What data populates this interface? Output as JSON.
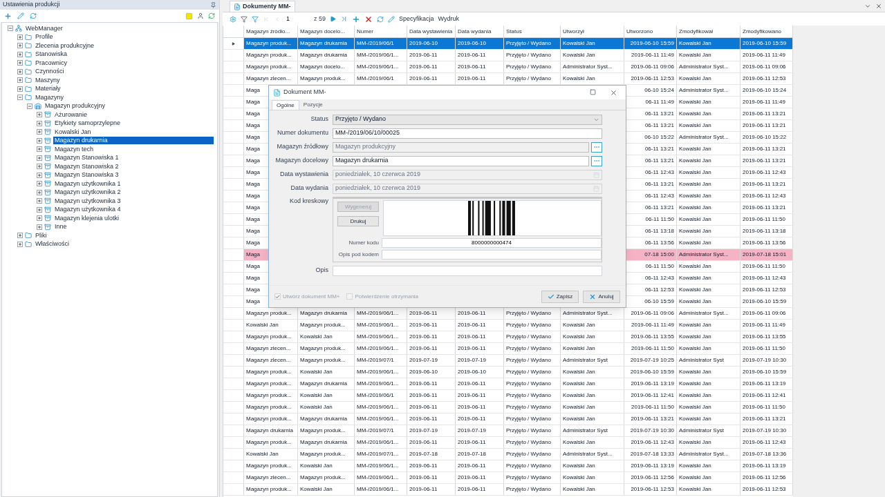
{
  "left_panel": {
    "title": "Ustawienia produkcji",
    "tree": [
      {
        "label": "WebManager",
        "expanded": true,
        "selected": false,
        "children": [
          {
            "label": "Profile",
            "expanded": false,
            "selected": false
          },
          {
            "label": "Zlecenia produkcyjne",
            "expanded": false,
            "selected": false
          },
          {
            "label": "Stanowiska",
            "expanded": false,
            "selected": false
          },
          {
            "label": "Pracownicy",
            "expanded": false,
            "selected": false
          },
          {
            "label": "Czynności",
            "expanded": false,
            "selected": false
          },
          {
            "label": "Maszyny",
            "expanded": false,
            "selected": false
          },
          {
            "label": "Materiały",
            "expanded": false,
            "selected": false
          },
          {
            "label": "Magazyny",
            "expanded": true,
            "selected": false,
            "children": [
              {
                "label": "Magazyn produkcyjny",
                "expanded": true,
                "selected": false,
                "children": [
                  {
                    "label": "Ażurowanie",
                    "expanded": false,
                    "selected": false
                  },
                  {
                    "label": "Etykiety samoprzylepne",
                    "expanded": false,
                    "selected": false
                  },
                  {
                    "label": "Kowalski Jan",
                    "expanded": false,
                    "selected": false
                  },
                  {
                    "label": "Magazyn drukarnia",
                    "expanded": false,
                    "selected": true
                  },
                  {
                    "label": "Magazyn tech",
                    "expanded": false,
                    "selected": false
                  },
                  {
                    "label": "Magazyn Stanowiska 1",
                    "expanded": false,
                    "selected": false
                  },
                  {
                    "label": "Magazyn Stanowiska 2",
                    "expanded": false,
                    "selected": false
                  },
                  {
                    "label": "Magazyn Stanowiska 3",
                    "expanded": false,
                    "selected": false
                  },
                  {
                    "label": "Magazyn użytkownika 1",
                    "expanded": false,
                    "selected": false
                  },
                  {
                    "label": "Magazyn użytkownika 2",
                    "expanded": false,
                    "selected": false
                  },
                  {
                    "label": "Magazyn użytkownika 3",
                    "expanded": false,
                    "selected": false
                  },
                  {
                    "label": "Magazyn użytkownika 4",
                    "expanded": false,
                    "selected": false
                  },
                  {
                    "label": "Magazyn klejenia ulotki",
                    "expanded": false,
                    "selected": false
                  },
                  {
                    "label": "Inne",
                    "expanded": false,
                    "selected": false
                  }
                ]
              }
            ]
          },
          {
            "label": "Pliki",
            "expanded": false,
            "selected": false
          },
          {
            "label": "Właściwości",
            "expanded": false,
            "selected": false
          }
        ]
      }
    ]
  },
  "document_tab": {
    "label": "Dokumenty MM-",
    "selected": true
  },
  "toolbar": {
    "page": "1",
    "page_count": "z 59",
    "actions": [
      "Specyfikacja",
      "Wydruk"
    ]
  },
  "grid": {
    "columns": [
      "Magazyn źródło...",
      "Magazyn docelo...",
      "Numer",
      "Data wystawienia",
      "Data wydania",
      "Status",
      "Utworzył",
      "Utworzono",
      "Zmodyfikował",
      "Zmodyfikowano"
    ],
    "rows": [
      {
        "selected": true,
        "cells": [
          "Magazyn produk...",
          "Magazyn drukarnia",
          "MM-/2019/06/1",
          "2019-06-10",
          "2019-06-10",
          "Przyjęto / Wydano",
          "Kowalski Jan",
          "2019-06-10 15:59",
          "Kowalski Jan",
          "2019-06-10 15:59"
        ]
      },
      {
        "selected": false,
        "cells": [
          "Magazyn produk...",
          "Magazyn drukarnia",
          "MM-/2019/06/1...",
          "2019-06-11",
          "2019-06-11",
          "Przyjęto / Wydano",
          "Kowalski Jan",
          "2019-06-11 11:49",
          "Kowalski Jan",
          "2019-06-11 11:49"
        ]
      },
      {
        "selected": false,
        "cells": [
          "Magazyn produk...",
          "Magazyn docelo...",
          "MM-/2019/06/1...",
          "2019-06-11",
          "2019-06-11",
          "Przyjęto / Wydano",
          "Administrator Syst...",
          "2019-06-11 09:06",
          "Administrator Syst...",
          "2019-06-11 09:06"
        ]
      },
      {
        "selected": false,
        "cells": [
          "Magazyn zlecen...",
          "Magazyn produk...",
          "MM-/2019/06/1",
          "2019-06-11",
          "2019-06-11",
          "Przyjęto / Wydano",
          "Kowalski Jan",
          "2019-06-11 12:53",
          "Kowalski Jan",
          "2019-06-11 12:53"
        ]
      },
      {
        "selected": false,
        "cells": [
          "Maga",
          null,
          null,
          null,
          null,
          null,
          null,
          "06-10 15:24",
          "Administrator Syst...",
          "2019-06-10 15:24"
        ]
      },
      {
        "selected": false,
        "cells": [
          "Maga",
          null,
          null,
          null,
          null,
          null,
          null,
          "06-11 11:49",
          "Kowalski Jan",
          "2019-06-11 11:49"
        ]
      },
      {
        "selected": false,
        "cells": [
          "Maga",
          null,
          null,
          null,
          null,
          null,
          null,
          "06-11 13:21",
          "Kowalski Jan",
          "2019-06-11 13:21"
        ]
      },
      {
        "selected": false,
        "cells": [
          "Maga",
          null,
          null,
          null,
          null,
          null,
          null,
          "06-11 13:21",
          "Kowalski Jan",
          "2019-06-11 13:21"
        ]
      },
      {
        "selected": false,
        "cells": [
          "Maga",
          null,
          null,
          null,
          null,
          null,
          null,
          "06-10 15:22",
          "Administrator Syst...",
          "2019-06-10 15:22"
        ]
      },
      {
        "selected": false,
        "cells": [
          "Maga",
          null,
          null,
          null,
          null,
          null,
          null,
          "06-11 13:21",
          "Kowalski Jan",
          "2019-06-11 13:21"
        ]
      },
      {
        "selected": false,
        "cells": [
          "Maga",
          null,
          null,
          null,
          null,
          null,
          null,
          "06-11 13:21",
          "Kowalski Jan",
          "2019-06-11 13:21"
        ]
      },
      {
        "selected": false,
        "cells": [
          "Maga",
          null,
          null,
          null,
          null,
          null,
          null,
          "06-11 12:43",
          "Kowalski Jan",
          "2019-06-11 12:43"
        ]
      },
      {
        "selected": false,
        "cells": [
          "Maga",
          null,
          null,
          null,
          null,
          null,
          null,
          "06-11 13:21",
          "Kowalski Jan",
          "2019-06-11 13:21"
        ]
      },
      {
        "selected": false,
        "cells": [
          "Maga",
          null,
          null,
          null,
          null,
          null,
          null,
          "06-11 12:43",
          "Kowalski Jan",
          "2019-06-11 12:43"
        ]
      },
      {
        "selected": false,
        "cells": [
          "Maga",
          null,
          null,
          null,
          null,
          null,
          null,
          "06-11 13:21",
          "Kowalski Jan",
          "2019-06-11 13:21"
        ]
      },
      {
        "selected": false,
        "cells": [
          "Maga",
          null,
          null,
          null,
          null,
          null,
          null,
          "06-11 11:50",
          "Kowalski Jan",
          "2019-06-11 11:50"
        ]
      },
      {
        "selected": false,
        "cells": [
          "Maga",
          null,
          null,
          null,
          null,
          null,
          null,
          "06-11 13:18",
          "Kowalski Jan",
          "2019-06-11 13:18"
        ]
      },
      {
        "selected": false,
        "cells": [
          "Maga",
          null,
          null,
          null,
          null,
          null,
          null,
          "06-11 13:56",
          "Kowalski Jan",
          "2019-06-11 13:56"
        ]
      },
      {
        "selected": false,
        "color": "#f5b3c5",
        "cells": [
          "Maga",
          null,
          null,
          null,
          null,
          null,
          null,
          "07-18 15:00",
          "Administrator Syst...",
          "2019-07-18 15:01"
        ]
      },
      {
        "selected": false,
        "cells": [
          "Maga",
          null,
          null,
          null,
          null,
          null,
          null,
          "06-11 11:50",
          "Kowalski Jan",
          "2019-06-11 11:50"
        ]
      },
      {
        "selected": false,
        "cells": [
          "Maga",
          null,
          null,
          null,
          null,
          null,
          null,
          "06-11 12:43",
          "Kowalski Jan",
          "2019-06-11 12:43"
        ]
      },
      {
        "selected": false,
        "cells": [
          "Maga",
          null,
          null,
          null,
          null,
          null,
          null,
          "06-11 12:53",
          "Kowalski Jan",
          "2019-06-11 12:53"
        ]
      },
      {
        "selected": false,
        "cells": [
          "Maga",
          null,
          null,
          null,
          null,
          null,
          null,
          "06-10 15:59",
          "Kowalski Jan",
          "2019-06-10 15:59"
        ]
      },
      {
        "selected": false,
        "cells": [
          "Magazyn produk...",
          "Magazyn drukarnia",
          "MM-/2019/06/1...",
          "2019-06-11",
          "2019-06-11",
          "Przyjęto / Wydano",
          "Administrator Syst...",
          "2019-06-11 09:06",
          "Administrator Syst...",
          "2019-06-11 09:06"
        ]
      },
      {
        "selected": false,
        "cells": [
          "Kowalski Jan",
          "Magazyn produk...",
          "MM-/2019/06/1...",
          "2019-06-11",
          "2019-06-11",
          "Przyjęto / Wydano",
          "Kowalski Jan",
          "2019-06-11 11:49",
          "Kowalski Jan",
          "2019-06-11 11:49"
        ]
      },
      {
        "selected": false,
        "cells": [
          "Magazyn produk...",
          "Kowalski Jan",
          "MM-/2019/06/1...",
          "2019-06-11",
          "2019-06-11",
          "Przyjęto / Wydano",
          "Kowalski Jan",
          "2019-06-11 13:55",
          "Kowalski Jan",
          "2019-06-11 13:55"
        ]
      },
      {
        "selected": false,
        "cells": [
          "Magazyn zlecen...",
          "Magazyn produk...",
          "MM-/2019/06/1...",
          "2019-06-11",
          "2019-06-11",
          "Przyjęto / Wydano",
          "Kowalski Jan",
          "2019-06-11 11:50",
          "Kowalski Jan",
          "2019-06-11 11:50"
        ]
      },
      {
        "selected": false,
        "cells": [
          "Magazyn zlecen...",
          "Magazyn produk...",
          "MM-/2019/07/1",
          "2019-07-19",
          "2019-07-19",
          "Przyjęto / Wydano",
          "Administrator Syst",
          "2019-07-19 10:25",
          "Administrator Syst",
          "2019-07-19 10:30"
        ]
      },
      {
        "selected": false,
        "cells": [
          "Magazyn produk...",
          "Kowalski Jan",
          "MM-/2019/06/1...",
          "2019-06-10",
          "2019-06-10",
          "Przyjęto / Wydano",
          "Kowalski Jan",
          "2019-06-10 15:59",
          "Kowalski Jan",
          "2019-06-10 15:59"
        ]
      },
      {
        "selected": false,
        "cells": [
          "Magazyn produk...",
          "Magazyn drukarnia",
          "MM-/2019/06/1...",
          "2019-06-11",
          "2019-06-11",
          "Przyjęto / Wydano",
          "Kowalski Jan",
          "2019-06-11 13:19",
          "Kowalski Jan",
          "2019-06-11 13:19"
        ]
      },
      {
        "selected": false,
        "cells": [
          "Magazyn produk...",
          "Kowalski Jan",
          "MM-/2019/06/1",
          "2019-06-11",
          "2019-06-11",
          "Przyjęto / Wydano",
          "Kowalski Jan",
          "2019-06-11 12:41",
          "Kowalski Jan",
          "2019-06-11 12:41"
        ]
      },
      {
        "selected": false,
        "cells": [
          "Magazyn produk...",
          "Kowalski Jan",
          "MM-/2019/06/1...",
          "2019-06-11",
          "2019-06-11",
          "Przyjęto / Wydano",
          "Kowalski Jan",
          "2019-06-11 11:50",
          "Kowalski Jan",
          "2019-06-11 11:50"
        ]
      },
      {
        "selected": false,
        "cells": [
          "Magazyn produk...",
          "Magazyn drukarnia",
          "MM-/2019/06/1...",
          "2019-06-11",
          "2019-06-11",
          "Przyjęto / Wydano",
          "Kowalski Jan",
          "2019-06-11 13:21",
          "Kowalski Jan",
          "2019-06-11 13:21"
        ]
      },
      {
        "selected": false,
        "cells": [
          "Magazyn drukarnia",
          "Magazyn produk...",
          "MM-/2019/07/1",
          "2019-07-19",
          "2019-07-19",
          "Przyjęto / Wydano",
          "Administrator Syst",
          "2019-07-19 10:30",
          "Administrator Syst",
          "2019-07-19 10:30"
        ]
      },
      {
        "selected": false,
        "cells": [
          "Magazyn produk...",
          "Magazyn drukarnia",
          "MM-/2019/06/1...",
          "2019-06-11",
          "2019-06-11",
          "Przyjęto / Wydano",
          "Kowalski Jan",
          "2019-06-11 12:43",
          "Kowalski Jan",
          "2019-06-11 12:43"
        ]
      },
      {
        "selected": false,
        "cells": [
          "Kowalski Jan",
          "Magazyn produk...",
          "MM-/2019/07/1...",
          "2019-07-18",
          "2019-07-18",
          "Przyjęto / Wydano",
          "Administrator Syst...",
          "2019-07-18 13:33",
          "Administrator Syst...",
          "2019-07-18 13:36"
        ]
      },
      {
        "selected": false,
        "cells": [
          "Magazyn produk...",
          "Kowalski Jan",
          "MM-/2019/06/1...",
          "2019-06-11",
          "2019-06-11",
          "Przyjęto / Wydano",
          "Kowalski Jan",
          "2019-06-11 13:19",
          "Kowalski Jan",
          "2019-06-11 13:19"
        ]
      },
      {
        "selected": false,
        "cells": [
          "Magazyn zlecen...",
          "Magazyn produk...",
          "MM-/2019/06/1...",
          "2019-06-11",
          "2019-06-11",
          "Przyjęto / Wydano",
          "Kowalski Jan",
          "2019-06-11 12:56",
          "Kowalski Jan",
          "2019-06-11 12:56"
        ]
      },
      {
        "selected": false,
        "cells": [
          "Magazyn produk...",
          "Kowalski Jan",
          "MM-/2019/06/1...",
          "2019-06-11",
          "2019-06-11",
          "Przyjęto / Wydano",
          "Kowalski Jan",
          "2019-06-11 12:53",
          "Kowalski Jan",
          "2019-06-11 12:53"
        ]
      }
    ]
  },
  "dialog": {
    "title": "Dokument MM-",
    "tabs": [
      {
        "label": "Ogólne",
        "selected": true
      },
      {
        "label": "Pozycje",
        "selected": false
      }
    ],
    "fields": [
      {
        "label": "Status",
        "kind": "select",
        "value": "Przyjęto / Wydano",
        "disabled": false
      },
      {
        "label": "Numer dokumentu",
        "kind": "text",
        "value": "MM-/2019/06/10/00025",
        "disabled": false
      },
      {
        "label": "Magazyn źródłowy",
        "kind": "lookup",
        "value": "Magazyn produkcyjny",
        "disabled": true
      },
      {
        "label": "Magazyn docelowy",
        "kind": "lookup",
        "value": "Magazyn drukarnia",
        "disabled": false
      },
      {
        "label": "Data wystawienia",
        "kind": "date",
        "value": "poniedziałek, 10 czerwca 2019",
        "disabled": true
      },
      {
        "label": "Data wydania",
        "kind": "date",
        "value": "poniedziałek, 10 czerwca 2019",
        "disabled": true
      }
    ],
    "barcode": {
      "label": "Kod kreskowy",
      "buttons": [
        {
          "label": "Wygeneruj",
          "disabled": true
        },
        {
          "label": "Drukuj",
          "disabled": false
        }
      ],
      "code_label": "Numer kodu",
      "code": "8000000000474",
      "caption_label": "Opis pod kodem"
    },
    "description": {
      "label": "Opis"
    },
    "checkboxes": [
      {
        "label": "Utwórz dokument MM+",
        "checked": true,
        "disabled": true
      },
      {
        "label": "Potwierdzenie otrzymania",
        "checked": false,
        "disabled": true
      }
    ],
    "buttons": [
      "Zapisz",
      "Anuluj"
    ]
  }
}
